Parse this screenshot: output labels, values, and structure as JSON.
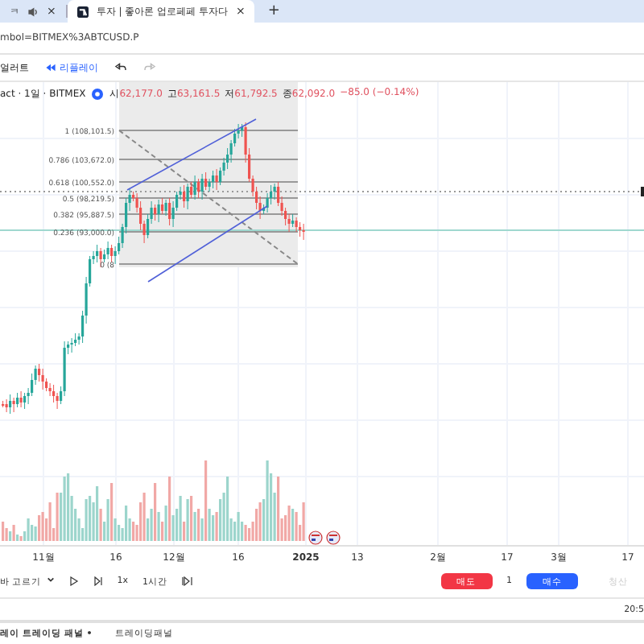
{
  "browser": {
    "tabs": [
      {
        "title": "ㅋ",
        "selected": false,
        "close": "×"
      },
      {
        "title": "투자 | 좋아론 업로페페 투자다",
        "selected": true,
        "close": "×"
      }
    ],
    "new_tab": "+",
    "address": "mbol=BITMEX%3ABTCUSD.P"
  },
  "toolbar": {
    "alert": "얼러트",
    "replay": "리플레이"
  },
  "legend": {
    "symbol": "act · 1일 · BITMEX",
    "ohlc": [
      {
        "label": "시",
        "value": "62,177.0"
      },
      {
        "label": "고",
        "value": "63,161.5"
      },
      {
        "label": "저",
        "value": "61,792.5"
      },
      {
        "label": "종",
        "value": "62,092.0"
      }
    ],
    "change": "−85.0 (−0.14%)"
  },
  "fib_levels": [
    {
      "label": "1 (108,101.5)"
    },
    {
      "label": "0.786 (103,672.0)"
    },
    {
      "label": "0.618 (100,552.0)"
    },
    {
      "label": "0.5 (98,219.5)"
    },
    {
      "label": "0.382 (95,887.5)"
    },
    {
      "label": "0.236 (93,000.0)"
    },
    {
      "label": "0 (8"
    }
  ],
  "time_axis": [
    "11월",
    "16",
    "12월",
    "16",
    "2025",
    "13",
    "2월",
    "17",
    "3월",
    "17"
  ],
  "replay_bar": {
    "select_bar": "바 고르기",
    "speed": "1x",
    "interval": "1시간",
    "sell": "매도",
    "quantity": "1",
    "buy": "매수",
    "close_position": "청산",
    "close_disabled": true
  },
  "clock": "20:5",
  "panels": [
    {
      "label": "레이 트레이딩 패널 •",
      "selected": true
    },
    {
      "label": "트레이딩패널",
      "selected": false
    }
  ]
}
